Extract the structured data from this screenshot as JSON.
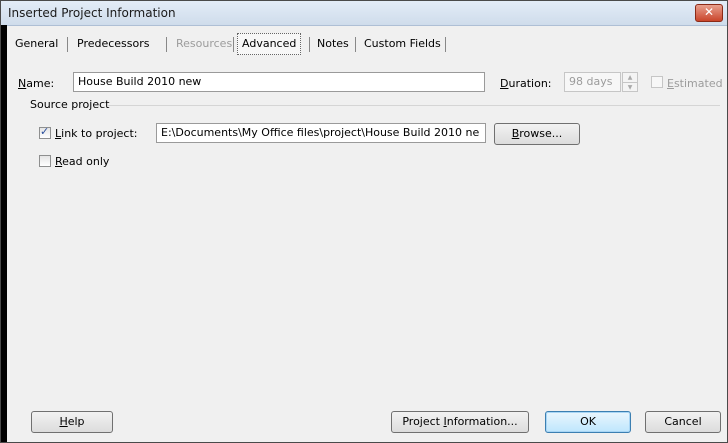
{
  "window": {
    "title": "Inserted Project Information",
    "close_label": "✕"
  },
  "tabs": [
    {
      "label": "General",
      "state": "normal"
    },
    {
      "label": "Predecessors",
      "state": "normal"
    },
    {
      "label": "Resources",
      "state": "disabled"
    },
    {
      "label": "Advanced",
      "state": "active"
    },
    {
      "label": "Notes",
      "state": "normal"
    },
    {
      "label": "Custom Fields",
      "state": "normal"
    }
  ],
  "name": {
    "label_first": "N",
    "label_rest": "ame:",
    "value": "House Build 2010 new"
  },
  "duration": {
    "label_first": "D",
    "label_rest": "uration:",
    "value": "98 days"
  },
  "estimated": {
    "label_first": "E",
    "label_rest": "stimated",
    "checked": false
  },
  "source_project": {
    "group_label": "Source project",
    "link": {
      "label_first": "L",
      "label_rest": "ink to project:",
      "checked": true,
      "path": "E:\\Documents\\My Office files\\project\\House Build 2010 ne"
    },
    "browse_first": "B",
    "browse_rest": "rowse...",
    "read_only": {
      "label_first": "R",
      "label_rest": "ead only",
      "checked": false
    }
  },
  "footer": {
    "help_first": "H",
    "help_rest": "elp",
    "project_info_pre": "Project ",
    "project_info_first": "I",
    "project_info_rest": "nformation...",
    "ok_label": "OK",
    "cancel_label": "Cancel"
  }
}
